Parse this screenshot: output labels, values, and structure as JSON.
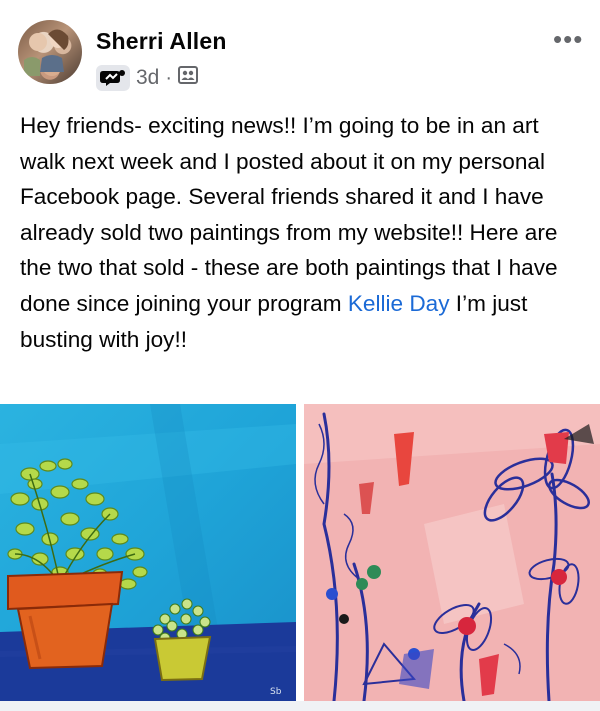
{
  "post": {
    "author": "Sherri Allen",
    "time": "3d",
    "separator": "·",
    "more_label": "•••",
    "text_before_mention": "Hey friends- exciting news!! I’m going to be in an art walk next week and I posted about it on my personal Facebook page. Several friends shared it and I have already sold two paintings from my website!! Here are the two that sold - these are both paintings that I have done since joining your program ",
    "mention": "Kellie Day",
    "text_after_mention": " I’m just busting with joy!!"
  },
  "icons": {
    "badge": "messenger-badge-icon",
    "audience": "members-audience-icon",
    "more": "more-options-icon"
  },
  "colors": {
    "mention": "#1b6ad6",
    "meta": "#65676b",
    "text": "#050505"
  }
}
